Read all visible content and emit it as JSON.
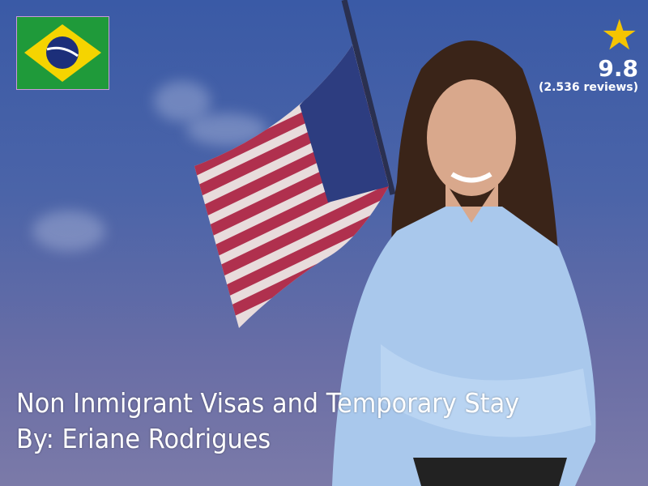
{
  "rating": {
    "icon": "star-icon",
    "score": "9.8",
    "reviews": "(2.536 reviews)"
  },
  "badge": {
    "icon": "brazil-flag-icon"
  },
  "title": "Non Inmigrant Visas and Temporary Stay",
  "author": "By: Eriane Rodrigues",
  "colors": {
    "star": "#f5c400",
    "text": "#ffffff"
  }
}
